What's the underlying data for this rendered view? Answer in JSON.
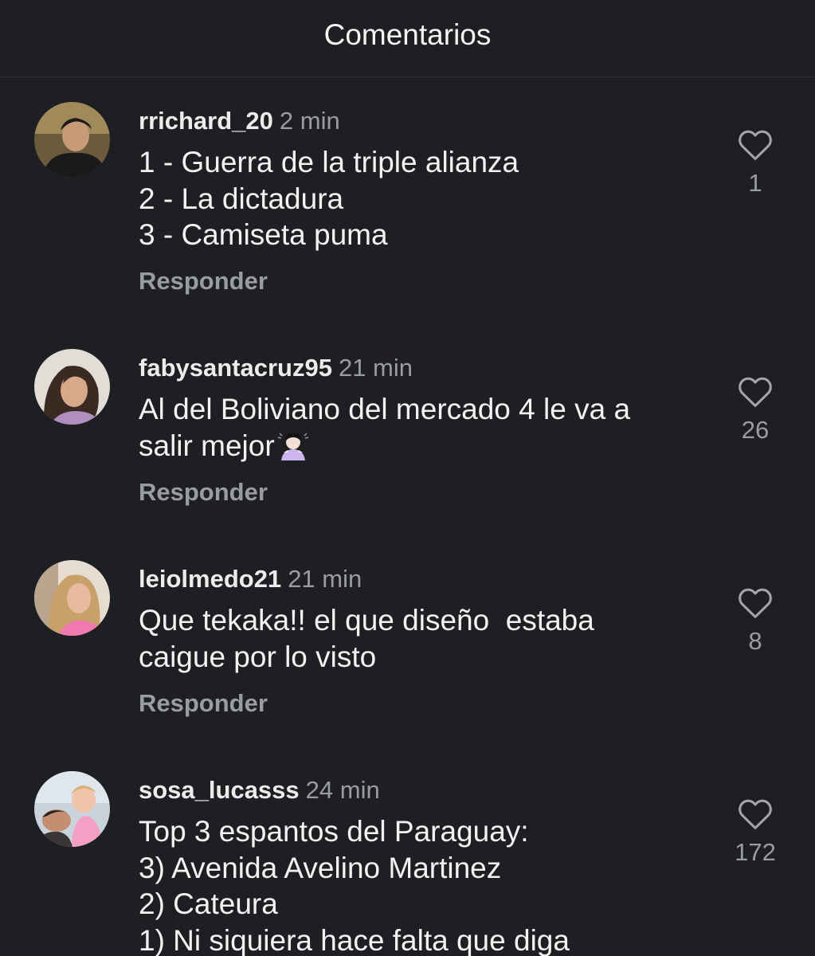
{
  "header": {
    "title": "Comentarios"
  },
  "actions": {
    "reply_label": "Responder"
  },
  "icons": {
    "like": "heart-outline-icon",
    "emoji": "woman-bowing-emoji"
  },
  "colors": {
    "background": "#1e1f22",
    "text_primary": "#f2f2f2",
    "text_secondary": "#9a9ca3",
    "divider": "#2f3034"
  },
  "comments": [
    {
      "username": "rrichard_20",
      "time": "2 min",
      "lines": [
        "1 - Guerra de la triple alianza",
        "2 - La dictadura",
        "3 - Camiseta puma"
      ],
      "likes": "1"
    },
    {
      "username": "fabysantacruz95",
      "time": "21 min",
      "lines": [
        "Al del Boliviano del mercado 4 le va a",
        "salir mejor"
      ],
      "likes": "26"
    },
    {
      "username": "leiolmedo21",
      "time": "21 min",
      "lines": [
        "Que tekaka!! el que diseño  estaba",
        "caigue por lo visto"
      ],
      "likes": "8"
    },
    {
      "username": "sosa_lucasss",
      "time": "24 min",
      "lines": [
        "Top 3 espantos del Paraguay:",
        "3) Avenida Avelino Martinez",
        "2) Cateura",
        "1) Ni siquiera hace falta que diga"
      ],
      "likes": "172"
    }
  ]
}
